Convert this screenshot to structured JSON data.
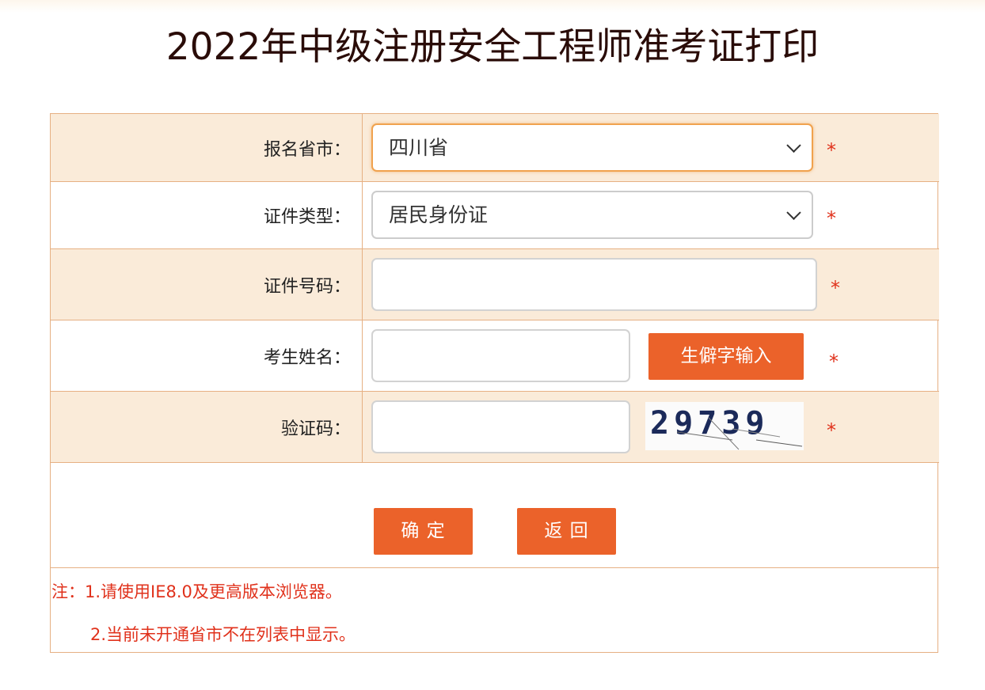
{
  "page": {
    "title": "2022年中级注册安全工程师准考证打印"
  },
  "form": {
    "province": {
      "label": "报名省市：",
      "value": "四川省"
    },
    "id_type": {
      "label": "证件类型：",
      "value": "居民身份证"
    },
    "id_number": {
      "label": "证件号码：",
      "value": ""
    },
    "name": {
      "label": "考生姓名：",
      "value": "",
      "rare_char_button": "生僻字输入"
    },
    "captcha": {
      "label": "验证码：",
      "value": "",
      "image_text": "29739"
    },
    "required_mark": "*"
  },
  "actions": {
    "confirm": "确 定",
    "back": "返 回"
  },
  "notes": {
    "line1": "注：1.请使用IE8.0及更高版本浏览器。",
    "line2": "2.当前未开通省市不在列表中显示。"
  },
  "colors": {
    "accent": "#eb622a",
    "row_alt": "#faebd9",
    "border": "#e6b083",
    "required": "#e0311b",
    "title": "#2a0c08"
  },
  "icons": {
    "select_arrow": "chevron-down-icon"
  }
}
